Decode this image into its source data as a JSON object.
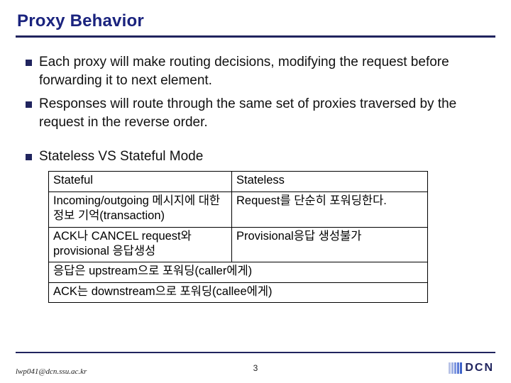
{
  "title": "Proxy Behavior",
  "bullets": {
    "b1": "Each proxy will make routing decisions, modifying the request before forwarding it to next element.",
    "b2": "Responses will route through the same set of proxies traversed by the request in the reverse order.",
    "b3": "Stateless VS Stateful Mode"
  },
  "table": {
    "r1c1": "Stateful",
    "r1c2": "Stateless",
    "r2c1": "Incoming/outgoing 메시지에 대한 정보 기억(transaction)",
    "r2c2": "Request를 단순히 포워딩한다.",
    "r3c1": "ACK나 CANCEL request와 provisional 응답생성",
    "r3c2": "Provisional응답 생성불가",
    "r4": "응답은 upstream으로 포워딩(caller에게)",
    "r5": "ACK는 downstream으로 포워딩(callee에게)"
  },
  "footer": {
    "email": "lwp041@dcn.ssu.ac.kr",
    "page": "3",
    "logo": "DCN"
  }
}
